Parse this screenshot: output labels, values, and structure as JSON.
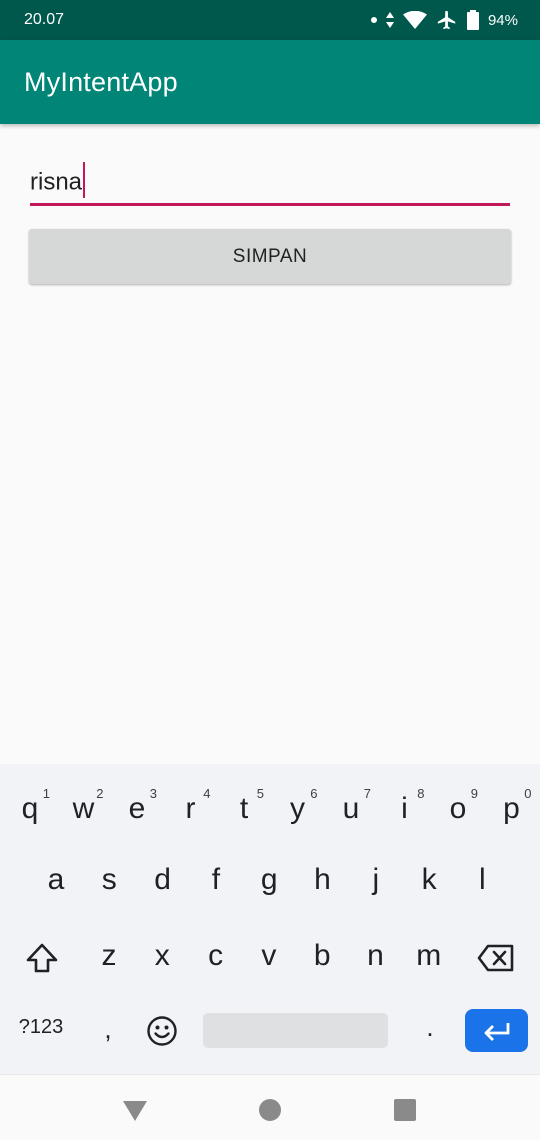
{
  "status_bar": {
    "time": "20.07",
    "battery_percent": "94%",
    "icons": [
      "notification-dot-icon",
      "data-arrows-icon",
      "wifi-icon",
      "airplane-mode-icon",
      "battery-icon"
    ]
  },
  "app_bar": {
    "title": "MyIntentApp",
    "color": "#008577",
    "status_color": "#00574b"
  },
  "form": {
    "input_value": "risna",
    "accent_color": "#c2185b",
    "save_button_label": "SIMPAN"
  },
  "keyboard": {
    "row1": [
      {
        "key": "q",
        "hint": "1"
      },
      {
        "key": "w",
        "hint": "2"
      },
      {
        "key": "e",
        "hint": "3"
      },
      {
        "key": "r",
        "hint": "4"
      },
      {
        "key": "t",
        "hint": "5"
      },
      {
        "key": "y",
        "hint": "6"
      },
      {
        "key": "u",
        "hint": "7"
      },
      {
        "key": "i",
        "hint": "8"
      },
      {
        "key": "o",
        "hint": "9"
      },
      {
        "key": "p",
        "hint": "0"
      }
    ],
    "row2": [
      "a",
      "s",
      "d",
      "f",
      "g",
      "h",
      "j",
      "k",
      "l"
    ],
    "row3": [
      "z",
      "x",
      "c",
      "v",
      "b",
      "n",
      "m"
    ],
    "symbols_label": "?123",
    "comma": ",",
    "period": ".",
    "enter_color": "#1a73e8"
  },
  "nav_bar": {
    "icons": [
      "back-icon",
      "home-icon",
      "recents-icon"
    ]
  }
}
